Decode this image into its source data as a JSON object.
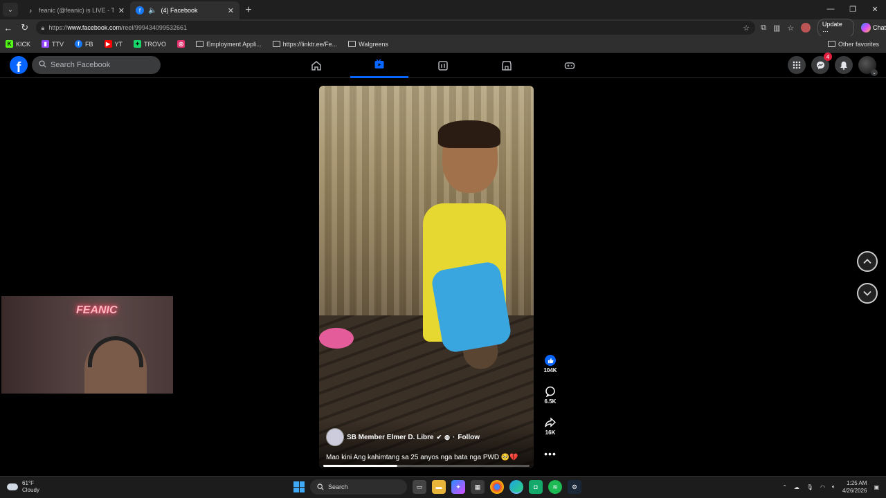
{
  "browser": {
    "tabs": [
      {
        "title": "feanic (@feanic) is LIVE - TikTok LI",
        "active": false
      },
      {
        "title": "(4) Facebook",
        "active": true
      }
    ],
    "url_prefix": "https://",
    "url_host": "www.facebook.com",
    "url_path": "/reel/999434099532661",
    "update_label": "Update",
    "update_more": "⋯",
    "chat_label": "Chat",
    "bookmarks": [
      {
        "label": "KICK",
        "icon": "kick-icon",
        "color": "#53fc18"
      },
      {
        "label": "TTV",
        "icon": "twitch-icon",
        "color": "#9146ff"
      },
      {
        "label": "FB",
        "icon": "facebook-icon",
        "color": "#1877f2"
      },
      {
        "label": "YT",
        "icon": "youtube-icon",
        "color": "#ff0000"
      },
      {
        "label": "TROVO",
        "icon": "trovo-icon",
        "color": "#19d66b"
      },
      {
        "label": "",
        "icon": "instagram-icon",
        "color": "#e1306c"
      },
      {
        "label": "Employment Appli...",
        "icon": "folder-icon"
      },
      {
        "label": "https://linktr.ee/Fe...",
        "icon": "folder-icon"
      },
      {
        "label": "Walgreens",
        "icon": "folder-icon"
      }
    ],
    "other_favorites": "Other favorites"
  },
  "facebook": {
    "search_placeholder": "Search Facebook",
    "messenger_badge": "4",
    "accent": "#0866ff"
  },
  "reel": {
    "author": "SB Member Elmer D. Libre",
    "follow_label": "Follow",
    "caption": "Mao kini Ang kahimtang sa 25 anyos nga bata nga PWD 🥺💔",
    "progress": 0.36,
    "likes": "104K",
    "comments": "6.5K",
    "shares": "16K"
  },
  "webcam": {
    "sign_text": "FEANIC"
  },
  "taskbar": {
    "temperature": "61°F",
    "weather": "Cloudy",
    "search_label": "Search",
    "time": "1:25 AM",
    "date": "4/26/2026"
  }
}
